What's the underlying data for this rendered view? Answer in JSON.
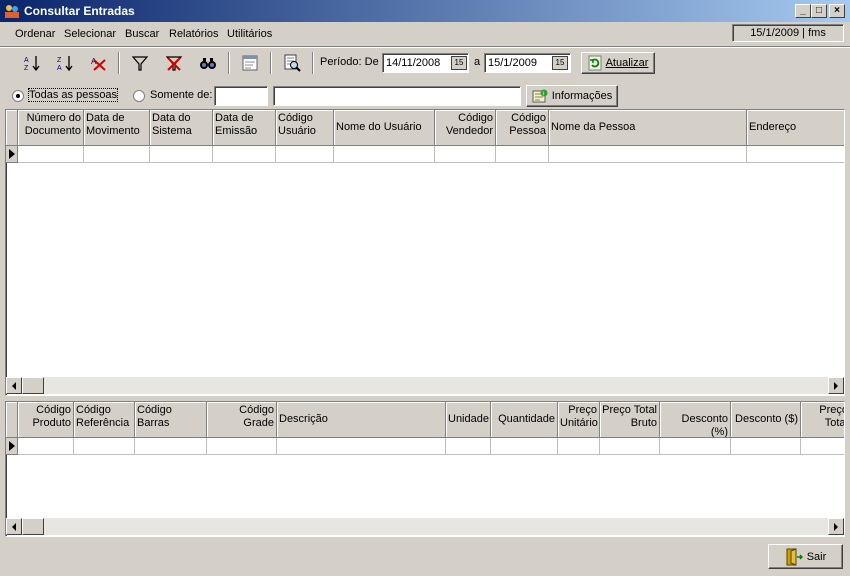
{
  "window": {
    "title": "Consultar Entradas"
  },
  "menu": [
    "Ordenar",
    "Selecionar",
    "Buscar",
    "Relatórios",
    "Utilitários"
  ],
  "status": "15/1/2009 | fms",
  "toolbar": {
    "periodo_label": "Período: De",
    "date_from": "14/11/2008",
    "a_label": "a",
    "date_to": "15/1/2009",
    "calendar_glyph": "15",
    "atualizar_label": "Atualizar"
  },
  "filter": {
    "todas_label": "Todas as pessoas",
    "somente_label": "Somente de:",
    "code_value": "",
    "name_value": "",
    "informacoes_label": "Informações"
  },
  "grid_top": {
    "columns": [
      "Número do Documento",
      "Data de Movimento",
      "Data do Sistema",
      "Data de Emissão",
      "Código Usuário",
      "Nome do Usuário",
      "Código Vendedor",
      "Código Pessoa",
      "Nome da Pessoa",
      "Endereço"
    ]
  },
  "grid_bottom": {
    "columns": [
      "Código Produto",
      "Código Referência",
      "Código Barras",
      "Código Grade",
      "Descrição",
      "Unidade",
      "Quantidade",
      "Preço Unitário",
      "Preço Total Bruto",
      "Desconto (%)",
      "Desconto ($)",
      "Preço Total"
    ]
  },
  "footer": {
    "sair_label": "Sair"
  },
  "icons": [
    "sort-az-icon",
    "sort-za-icon",
    "clear-sort-icon",
    "filter-icon",
    "clear-filter-icon",
    "find-icon",
    "report-icon",
    "preview-icon",
    "refresh-icon",
    "info-icon",
    "exit-door-icon"
  ]
}
